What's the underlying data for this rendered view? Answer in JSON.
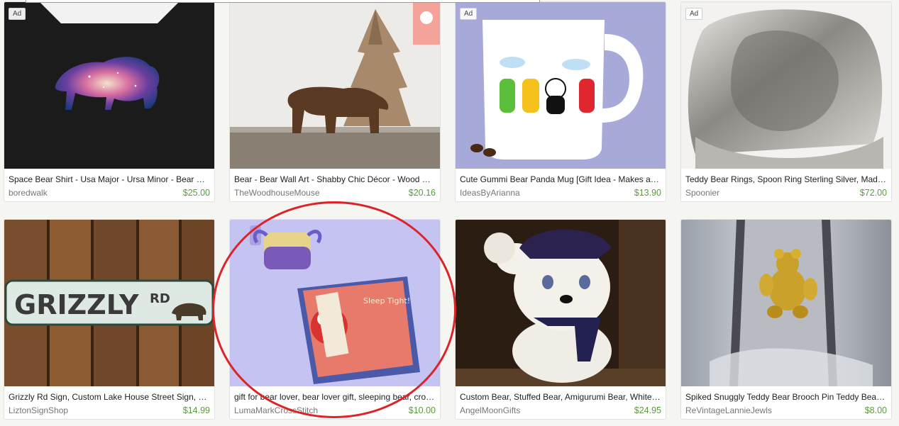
{
  "listings": [
    {
      "ad": "Ad",
      "title": "Space Bear Shirt - Usa Major - Ursa Minor - Bear Space Galaxy",
      "shop": "boredwalk",
      "price": "$25.00"
    },
    {
      "ad": "",
      "title": "Bear - Bear Wall Art - Shabby Chic Décor - Wood Bear Sign",
      "shop": "TheWoodhouseMouse",
      "price": "$20.16"
    },
    {
      "ad": "Ad",
      "title": "Cute Gummi Bear Panda Mug [Gift Idea - Makes a Great Gift]",
      "shop": "IdeasByArianna",
      "price": "$13.90"
    },
    {
      "ad": "Ad",
      "title": "Teddy Bear Rings, Spoon Ring Sterling Silver, Made From Spoon",
      "shop": "Spoonier",
      "price": "$72.00"
    },
    {
      "ad": "",
      "title": "Grizzly Rd Sign, Custom Lake House Street Sign, Bear Decor",
      "shop": "LiztonSignShop",
      "price": "$14.99"
    },
    {
      "ad": "",
      "title": "gift for bear lover, bear lover gift, sleeping bear, cross stitch",
      "shop": "LumaMarkCrossStitch",
      "price": "$10.00"
    },
    {
      "ad": "",
      "title": "Custom Bear, Stuffed Bear, Amigurumi Bear, White Bear",
      "shop": "AngelMoonGifts",
      "price": "$24.95"
    },
    {
      "ad": "",
      "title": "Spiked Snuggly Teddy Bear Brooch Pin Teddy Bear Jewelry",
      "shop": "ReVintageLannieJewls",
      "price": "$8.00"
    }
  ],
  "images": {
    "grizzly_sign_text": "GRIZZLY",
    "grizzly_sign_sup": "RD"
  },
  "colors": {
    "price": "#5a9b3e",
    "highlight": "#dc2428"
  }
}
